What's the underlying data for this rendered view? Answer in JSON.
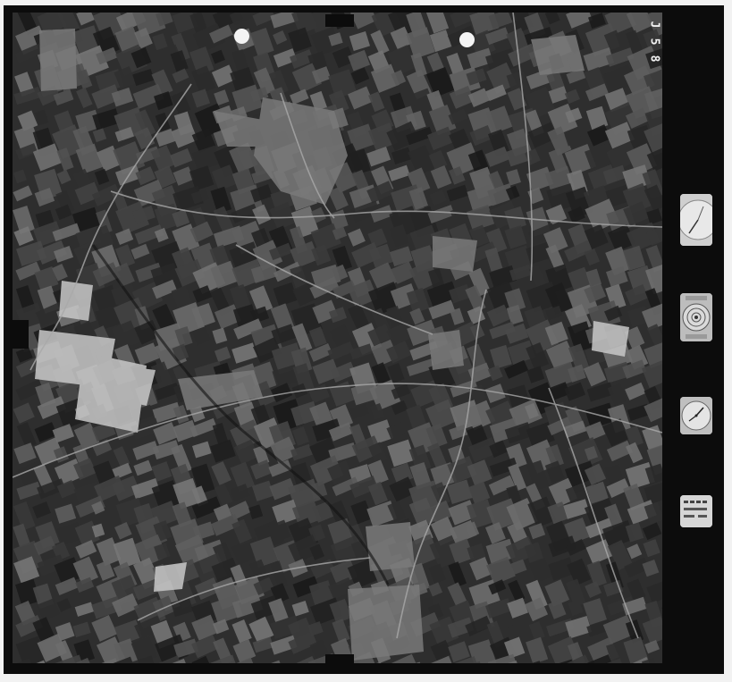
{
  "frame_number": [
    "J",
    "5",
    "8"
  ],
  "instruments": {
    "altimeter": {
      "icon": "altimeter-icon"
    },
    "level": {
      "icon": "bubble-level-icon"
    },
    "clock": {
      "icon": "clock-icon"
    },
    "counter": {
      "icon": "counter-plate-icon"
    }
  },
  "colors": {
    "border": "#0c0c0c",
    "paper": "#f2f2f2",
    "terrain": "#2e2e2e"
  }
}
